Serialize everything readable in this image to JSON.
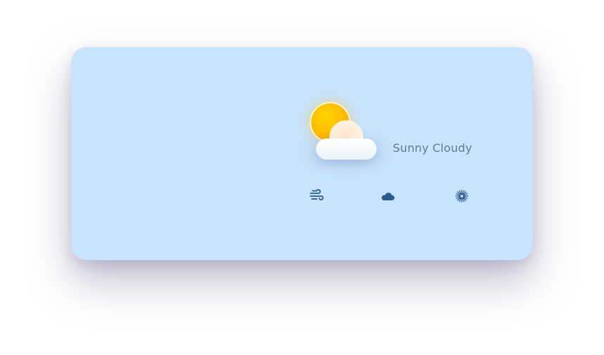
{
  "weather": {
    "condition": "Sunny Cloudy",
    "main_icon": "sun-behind-cloud-icon",
    "detail_icons": [
      "wind-icon",
      "cloud-icon",
      "sun-icon"
    ]
  },
  "colors": {
    "card_background": "#c8e3fc",
    "text": "#5c7c98",
    "icon": "#2d5a8c",
    "sun": "#ffbf00"
  }
}
